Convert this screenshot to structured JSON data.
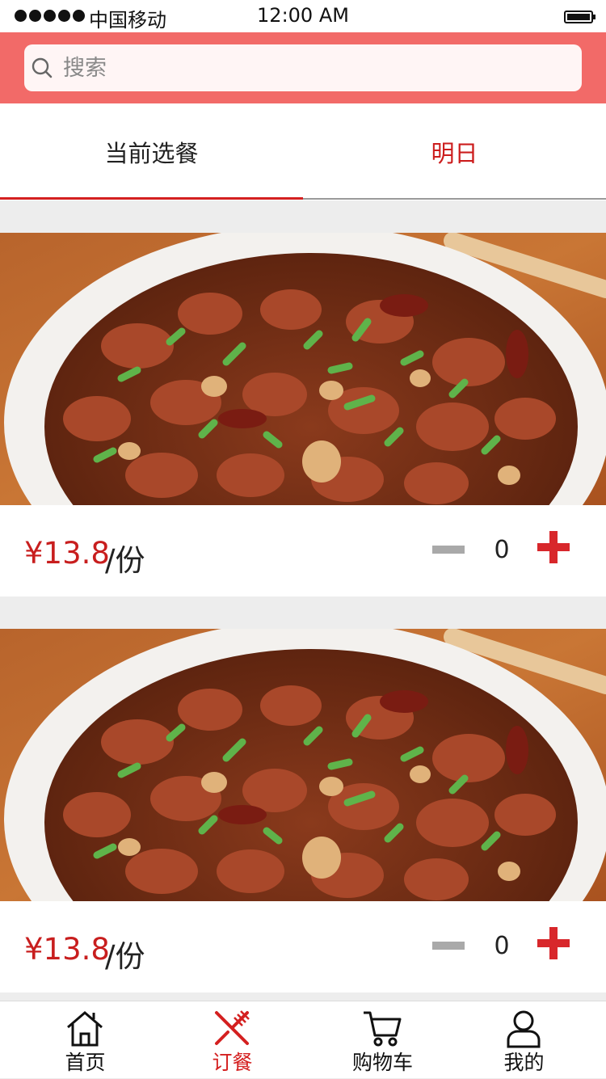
{
  "status_bar": {
    "carrier": "中国移动",
    "time": "12:00 AM"
  },
  "search": {
    "placeholder": "搜索"
  },
  "tabs": [
    {
      "label": "当前选餐",
      "active": true
    },
    {
      "label": "明日",
      "active": false
    }
  ],
  "items": [
    {
      "price": "¥13.8",
      "unit": "/份",
      "quantity": "0"
    },
    {
      "price": "¥13.8",
      "unit": "/份",
      "quantity": "0"
    }
  ],
  "tabbar": [
    {
      "label": "首页",
      "icon": "home-icon"
    },
    {
      "label": "订餐",
      "icon": "fork-knife-icon",
      "active": true
    },
    {
      "label": "购物车",
      "icon": "cart-icon"
    },
    {
      "label": "我的",
      "icon": "user-icon"
    }
  ],
  "colors": {
    "header": "#f26a68",
    "accent": "#d42020",
    "plus": "#d8272b"
  }
}
